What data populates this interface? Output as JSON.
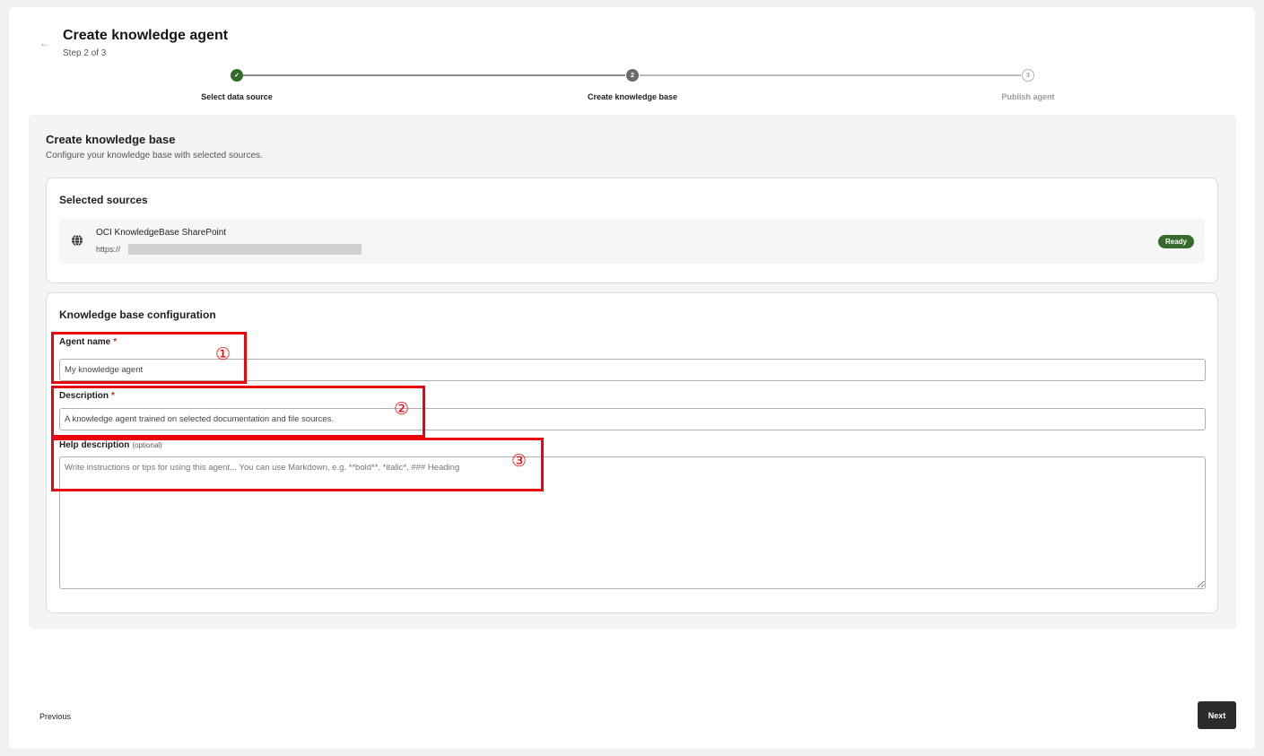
{
  "header": {
    "back_icon": "arrow-left-icon",
    "title": "Create knowledge agent",
    "step_text": "Step 2 of 3"
  },
  "stepper": {
    "steps": [
      {
        "label": "Select data source",
        "state": "done",
        "marker": "✓"
      },
      {
        "label": "Create knowledge base",
        "state": "active",
        "marker": "2"
      },
      {
        "label": "Publish agent",
        "state": "todo",
        "marker": "3"
      }
    ]
  },
  "section": {
    "title": "Create knowledge base",
    "subtitle": "Configure your knowledge base with selected sources."
  },
  "sources": {
    "title": "Selected sources",
    "items": [
      {
        "icon": "globe-icon",
        "name": "OCI KnowledgeBase SharePoint",
        "url_prefix": "https://",
        "status": "Ready",
        "status_color": "#356b2a"
      }
    ]
  },
  "config": {
    "title": "Knowledge base configuration",
    "agent_name": {
      "label": "Agent name",
      "required_mark": "*",
      "value": "My knowledge agent"
    },
    "description": {
      "label": "Description",
      "required_mark": "*",
      "value": "A knowledge agent trained on selected documentation and file sources."
    },
    "help_description": {
      "label": "Help description",
      "optional_text": "(optional)",
      "placeholder": "Write instructions or tips for using this agent... You can use Markdown, e.g. **bold**, *italic*, ### Heading"
    }
  },
  "annotations": [
    "①",
    "②",
    "③"
  ],
  "footer": {
    "previous_label": "Previous",
    "next_label": "Next"
  },
  "colors": {
    "accent_green": "#356b2a",
    "annotation_red": "#e8070d",
    "next_button": "#2c2c2c"
  }
}
